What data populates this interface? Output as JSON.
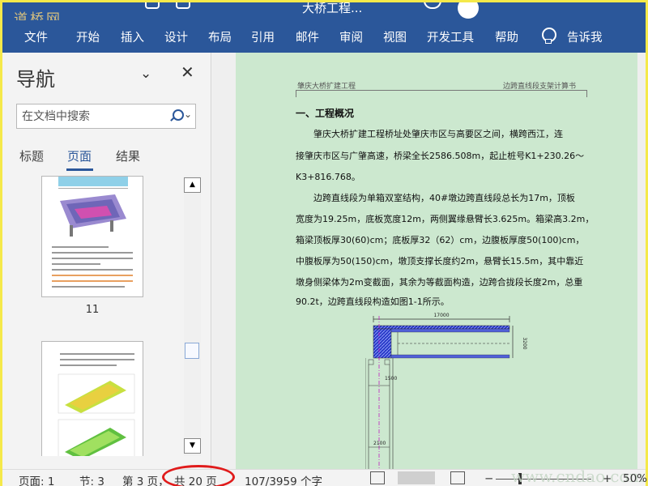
{
  "title_bar": {
    "watermark": "道桥网",
    "title_fragment": "大桥工程..."
  },
  "menu": {
    "items": [
      {
        "label": "文件",
        "name": "menu-file"
      },
      {
        "label": "开始",
        "name": "menu-home"
      },
      {
        "label": "插入",
        "name": "menu-insert"
      },
      {
        "label": "设计",
        "name": "menu-design"
      },
      {
        "label": "布局",
        "name": "menu-layout"
      },
      {
        "label": "引用",
        "name": "menu-references"
      },
      {
        "label": "邮件",
        "name": "menu-mailings"
      },
      {
        "label": "审阅",
        "name": "menu-review"
      },
      {
        "label": "视图",
        "name": "menu-view"
      },
      {
        "label": "开发工具",
        "name": "menu-developer"
      },
      {
        "label": "帮助",
        "name": "menu-help"
      }
    ],
    "tell_me": "告诉我"
  },
  "nav_pane": {
    "title": "导航",
    "search_placeholder": "在文档中搜索",
    "tabs": [
      {
        "label": "标题",
        "active": false
      },
      {
        "label": "页面",
        "active": true
      },
      {
        "label": "结果",
        "active": false
      }
    ],
    "page_thumbnails": [
      {
        "page_number": "11"
      },
      {
        "page_number": ""
      }
    ]
  },
  "document": {
    "header_left": "肇庆大桥扩建工程",
    "header_right": "边跨直线段支架计算书",
    "heading": "一、工程概况",
    "paragraph1": [
      "肇庆大桥扩建工程桥址处肇庆市区与高要区之间，横跨西江，连",
      "接肇庆市区与广肇高速，桥梁全长2586.508m，起止桩号K1+230.26～",
      "K3+816.768。"
    ],
    "paragraph2": [
      "边跨直线段为单箱双室结构，40#墩边跨直线段总长为17m，顶板",
      "宽度为19.25m，底板宽度12m，两侧翼缘悬臂长3.625m。箱梁高3.2m，",
      "箱梁顶板厚30(60)cm；底板厚32（62）cm，边腹板厚度50(100)cm，",
      "中腹板厚为50(150)cm，墩顶支撑长度约2m，悬臂长15.5m，其中靠近",
      "墩身侧梁体为2m变截面，其余为等截面构造，边跨合拢段长度2m，总重",
      "90.2t，边跨直线段构造如图1-1所示。"
    ],
    "drawing": {
      "dim_top": "17000",
      "dim_side": "3200",
      "dim_mid": "1500",
      "dim_low": "2100"
    }
  },
  "status_bar": {
    "page": "页面: 1",
    "section": "节: 3",
    "page_of": "第 3 页，",
    "total_pages": "共 20 页",
    "word_count": "107/3959 个字",
    "zoom": "50%",
    "watermark": "www.cndao.com"
  },
  "colors": {
    "ribbon": "#2b579a",
    "page_background": "#cce8cf",
    "highlight_circle": "#e01b1b"
  }
}
